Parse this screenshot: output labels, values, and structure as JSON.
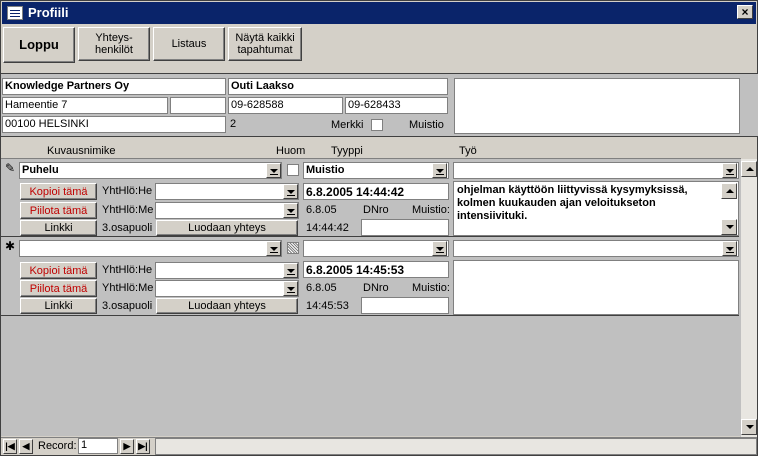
{
  "window": {
    "title": "Profiili",
    "close_label": "×"
  },
  "toolbar": {
    "loppu": "Loppu",
    "yhteyshenkilot": "Yhteys-\nhenkilöt",
    "listaus": "Listaus",
    "nayta": "Näytä kaikki\ntapahtumat"
  },
  "header": {
    "company": "Knowledge Partners Oy",
    "contact_name": "Outi Laakso",
    "street": "Hameentie 7",
    "street2": "",
    "phone1": "09-628588",
    "phone2": "09-628433",
    "postal": "00100 HELSINKI",
    "count": "2",
    "merkki_label": "Merkki",
    "muistio_label": "Muistio",
    "notes": ""
  },
  "columns": {
    "kuvausnimike": "Kuvausnimike",
    "huom": "Huom",
    "tyyppi": "Tyyppi",
    "tyo": "Työ"
  },
  "records": [
    {
      "selector": "✎",
      "kuvaus": "Puhelu",
      "tyyppi": "Muistio",
      "tyo_select": "",
      "copy_label": "Kopioi tämä",
      "hide_label": "Piilota tämä",
      "link_label": "Linkki",
      "yht1_label": "YhtHlö:He",
      "yht1_value": "",
      "yht2_label": "YhtHlö:Me",
      "yht2_value": "",
      "third_party": "3.osapuoli",
      "create_link": "Luodaan yhteys",
      "datetime": "6.8.2005 14:44:42",
      "date": "6.8.05",
      "dnro_label": "DNro",
      "muistio_label": "Muistio:",
      "time": "14:44:42",
      "work_text": "ohjelman käyttöön liittyvissä kysymyksissä, kolmen kuukauden ajan veloitukseton intensiivituki."
    },
    {
      "selector": "✱",
      "kuvaus": "",
      "tyyppi": "",
      "tyo_select": "",
      "copy_label": "Kopioi tämä",
      "hide_label": "Piilota tämä",
      "link_label": "Linkki",
      "yht1_label": "YhtHlö:He",
      "yht1_value": "",
      "yht2_label": "YhtHlö:Me",
      "yht2_value": "",
      "third_party": "3.osapuoli",
      "create_link": "Luodaan yhteys",
      "datetime": "6.8.2005 14:45:53",
      "date": "6.8.05",
      "dnro_label": "DNro",
      "muistio_label": "Muistio:",
      "time": "14:45:53",
      "work_text": ""
    }
  ],
  "navigation": {
    "record_label": "Record:",
    "record_value": "1",
    "first": "|◀",
    "prev": "◀",
    "next": "▶",
    "last": "▶|"
  }
}
